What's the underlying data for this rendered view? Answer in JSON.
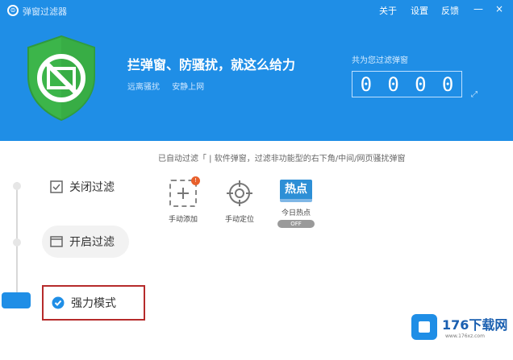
{
  "app": {
    "title": "弹窗过滤器"
  },
  "topnav": {
    "about": "关于",
    "settings": "设置",
    "feedback": "反馈"
  },
  "window": {
    "minimize": "—",
    "close": "×"
  },
  "hero": {
    "slogan": "拦弹窗、防骚扰，就这么给力",
    "link_1": "远离骚扰",
    "link_2": "安静上网"
  },
  "counter": {
    "label": "共为您过滤弹窗",
    "digits": [
      "0",
      "0",
      "0",
      "0"
    ]
  },
  "info_line": "已自动过滤「 |  软件弹窗，过滤非功能型的右下角/中间/网页骚扰弹窗",
  "modes": [
    {
      "label": "关闭过滤"
    },
    {
      "label": "开启过滤"
    },
    {
      "label": "强力模式"
    }
  ],
  "tools": [
    {
      "label": "手动添加",
      "badge": "!"
    },
    {
      "label": "手动定位"
    },
    {
      "label": "今日热点",
      "icon_text": "热点",
      "toggle": "OFF"
    }
  ],
  "watermark": {
    "title": "176下载网",
    "url": "www.176xz.com"
  },
  "colors": {
    "header": "#1f8ee6",
    "shield": "#3cb54a",
    "highlight_border": "#b62b2b"
  }
}
